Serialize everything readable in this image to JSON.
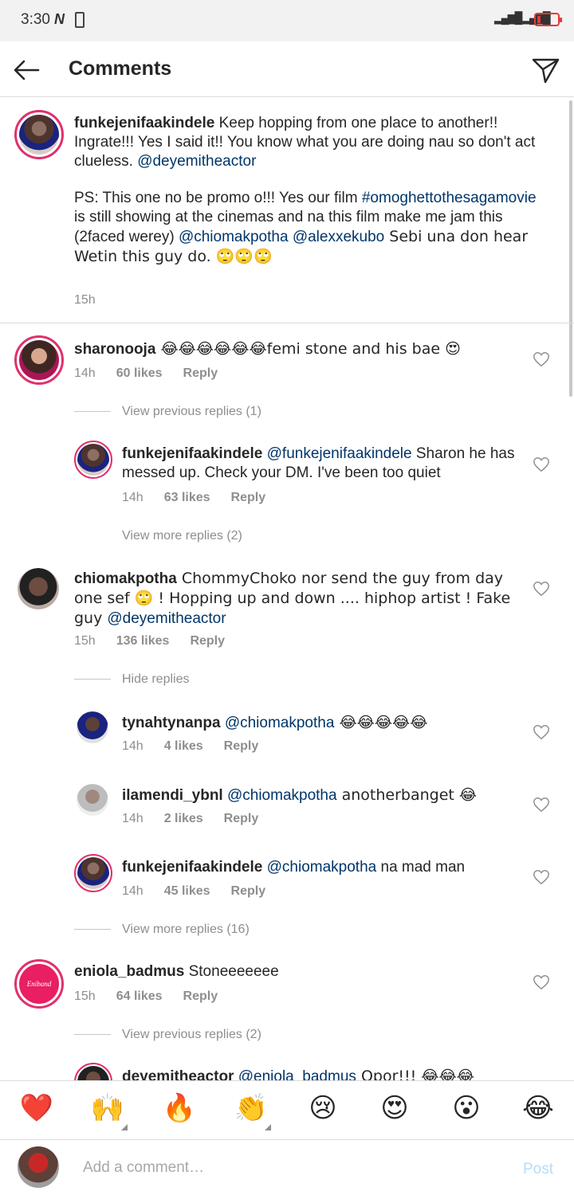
{
  "status_bar": {
    "time": "3:30",
    "nfc_icon": "N"
  },
  "header": {
    "title": "Comments",
    "back_icon": "arrow-left-icon",
    "share_icon": "paper-plane-icon"
  },
  "caption": {
    "username": "funkejenifaakindele",
    "text1": " Keep hopping from one place to another!! Ingrate!!! Yes I said it!! You know what you are doing nau so don't act clueless. ",
    "mention1": "@deyemitheactor",
    "ps_text1": "PS: This one no be promo o!!! Yes our film ",
    "hashtag": "#omoghettothesagamovie",
    "ps_text2": " is still showing at the cinemas and na this film make me jam this (2faced werey) ",
    "mention2": "@chiomakpotha",
    "mention3": "@alexxekubo",
    "ps_text3": " Sebi  una don hear Wetin this guy do. 🙄🙄🙄",
    "time": "15h"
  },
  "comments": [
    {
      "username": "sharonooja",
      "text": " 😂😂😂😂😂😂femi stone and his bae 😍",
      "time": "14h",
      "likes": "60 likes",
      "reply": "Reply",
      "view_previous": "View previous replies (1)",
      "replies": [
        {
          "username": "funkejenifaakindele",
          "mention": "@funkejenifaakindele",
          "text": " Sharon he has messed up. Check your DM. I've been too quiet",
          "time": "14h",
          "likes": "63 likes",
          "reply": "Reply"
        }
      ],
      "view_more": "View more replies (2)"
    },
    {
      "username": "chiomakpotha",
      "text": " ChommyChoko nor send the guy from day one sef 🙄 ! Hopping up and down .... hiphop artist ! Fake guy ",
      "mention": "@deyemitheactor",
      "time": "15h",
      "likes": "136 likes",
      "reply": "Reply",
      "hide_replies": "Hide replies",
      "replies": [
        {
          "username": "tynahtynanpa",
          "mention": "@chiomakpotha",
          "text": " 😂😂😂😂😂",
          "time": "14h",
          "likes": "4 likes",
          "reply": "Reply"
        },
        {
          "username": "ilamendi_ybnl",
          "mention": "@chiomakpotha",
          "text": " anotherbanget 😂",
          "time": "14h",
          "likes": "2 likes",
          "reply": "Reply"
        },
        {
          "username": "funkejenifaakindele",
          "mention": "@chiomakpotha",
          "text": " na mad man",
          "time": "14h",
          "likes": "45 likes",
          "reply": "Reply"
        }
      ],
      "view_more": "View more replies (16)"
    },
    {
      "username": "eniola_badmus",
      "text": " Stoneeeeeee",
      "time": "15h",
      "likes": "64 likes",
      "reply": "Reply",
      "avatar_text": "Eniband",
      "view_previous": "View previous replies (2)",
      "replies": [
        {
          "username": "deyemitheactor",
          "mention": "@eniola_badmus",
          "text": " Opor!!! 😂😂😂"
        }
      ]
    }
  ],
  "reactions": [
    "❤️",
    "🙌",
    "🔥",
    "👏",
    "😢",
    "😍",
    "😮",
    "😂"
  ],
  "composer": {
    "placeholder": "Add a comment…",
    "post": "Post"
  },
  "colors": {
    "mention": "#003569",
    "muted": "#8e8e8e",
    "ring": "#e1306c",
    "post": "#b2dffc"
  }
}
